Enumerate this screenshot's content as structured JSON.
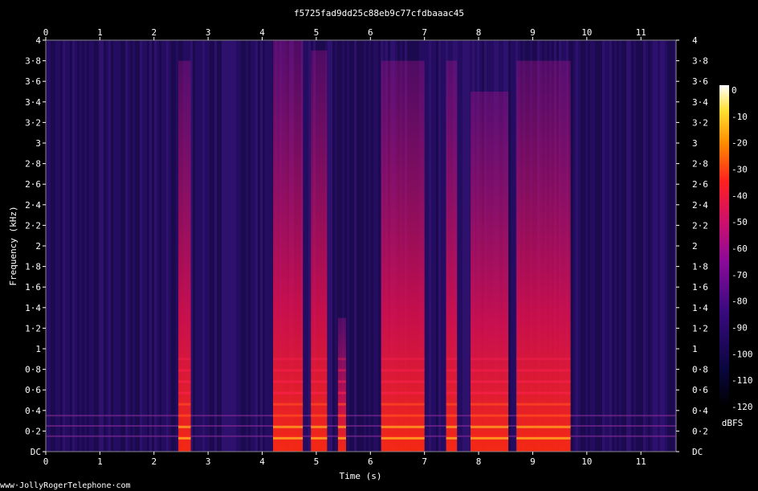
{
  "chart_data": {
    "type": "heatmap",
    "title": "f5725fad9dd25c88eb9c77cfdbaaac45",
    "xlabel": "Time (s)",
    "ylabel": "Frequency (kHz)",
    "x_ticks": [
      "0",
      "1",
      "2",
      "3",
      "4",
      "5",
      "6",
      "7",
      "8",
      "9",
      "10",
      "11"
    ],
    "y_ticks": [
      "DC",
      "0·2",
      "0·4",
      "0·6",
      "0·8",
      "1",
      "1·2",
      "1·4",
      "1·6",
      "1·8",
      "2",
      "2·2",
      "2·4",
      "2·6",
      "2·8",
      "3",
      "3·2",
      "3·4",
      "3·6",
      "3·8",
      "4"
    ],
    "xlim": [
      0,
      11.65
    ],
    "ylim": [
      0,
      4
    ],
    "colorbar": {
      "label": "dBFS",
      "ticks": [
        "0",
        "-10",
        "-20",
        "-30",
        "-40",
        "-50",
        "-60",
        "-70",
        "-80",
        "-90",
        "-100",
        "-110",
        "-120"
      ],
      "range": [
        -120,
        0
      ]
    },
    "energy_segments_s": [
      {
        "start": 2.45,
        "end": 2.68,
        "peak_kHz": 3.8
      },
      {
        "start": 4.2,
        "end": 4.75,
        "peak_kHz": 4.0
      },
      {
        "start": 4.9,
        "end": 5.2,
        "peak_kHz": 3.9
      },
      {
        "start": 5.4,
        "end": 5.55,
        "peak_kHz": 1.3
      },
      {
        "start": 6.2,
        "end": 7.0,
        "peak_kHz": 3.8
      },
      {
        "start": 7.4,
        "end": 7.6,
        "peak_kHz": 3.8
      },
      {
        "start": 7.85,
        "end": 8.55,
        "peak_kHz": 3.5
      },
      {
        "start": 8.7,
        "end": 9.7,
        "peak_kHz": 3.8
      }
    ]
  },
  "footer": {
    "credit": "www·JollyRogerTelephone·com"
  }
}
